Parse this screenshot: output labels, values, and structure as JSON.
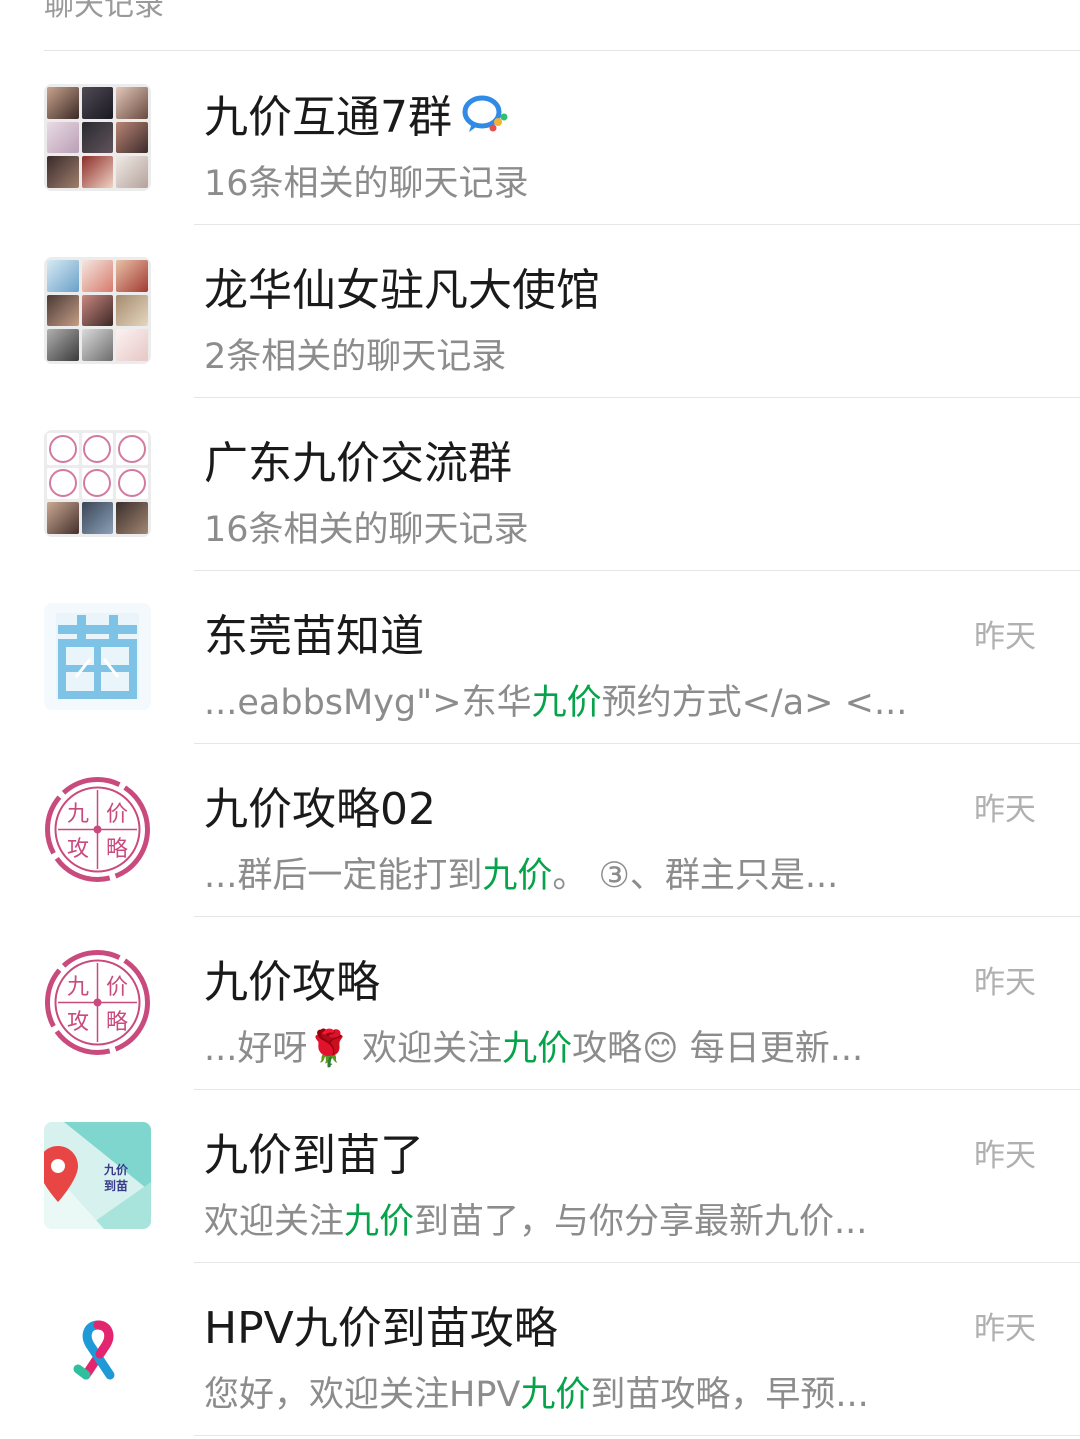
{
  "section_header": "聊天记录",
  "rows": [
    {
      "title": "九价互通7群",
      "subtitle": "16条相关的聊天记录",
      "avatar": "group-collage-photos",
      "badge": "wecom-group-icon"
    },
    {
      "title": "龙华仙女驻凡大使馆",
      "subtitle": "2条相关的聊天记录",
      "avatar": "group-collage-photos"
    },
    {
      "title": "广东九价交流群",
      "subtitle": "16条相关的聊天记录",
      "avatar": "group-collage-stamps"
    },
    {
      "title": "东莞苗知道",
      "time": "昨天",
      "snippet_pre": "...eabbsMyg\">东华",
      "snippet_hl": "九价",
      "snippet_post": "预约方式</a>   <...",
      "avatar": "miao-logo",
      "avatar_text": "苗"
    },
    {
      "title": "九价攻略02",
      "time": "昨天",
      "snippet_pre": "...群后一定能打到",
      "snippet_hl": "九价",
      "snippet_post": "。 ③、群主只是...",
      "avatar": "stamp-logo",
      "avatar_text": [
        "九",
        "价",
        "攻",
        "略"
      ]
    },
    {
      "title": "九价攻略",
      "time": "昨天",
      "snippet_pre": "...好呀🌹 欢迎关注",
      "snippet_hl": "九价",
      "snippet_post": "攻略😊 每日更新...",
      "avatar": "stamp-logo",
      "avatar_text": [
        "九",
        "价",
        "攻",
        "略"
      ]
    },
    {
      "title": "九价到苗了",
      "time": "昨天",
      "snippet_pre": "欢迎关注",
      "snippet_hl": "九价",
      "snippet_post": "到苗了，与你分享最新九价...",
      "avatar": "map-pin-logo",
      "avatar_text": [
        "九价",
        "到苗"
      ]
    },
    {
      "title": "HPV九价到苗攻略",
      "time": "昨天",
      "snippet_pre": "您好，欢迎关注HPV",
      "snippet_hl": "九价",
      "snippet_post": "到苗攻略，早预...",
      "avatar": "ribbon-logo"
    }
  ],
  "colors": {
    "highlight": "#07a34a",
    "stamp": "#c94a7c",
    "miao": "#7ec3e6"
  }
}
